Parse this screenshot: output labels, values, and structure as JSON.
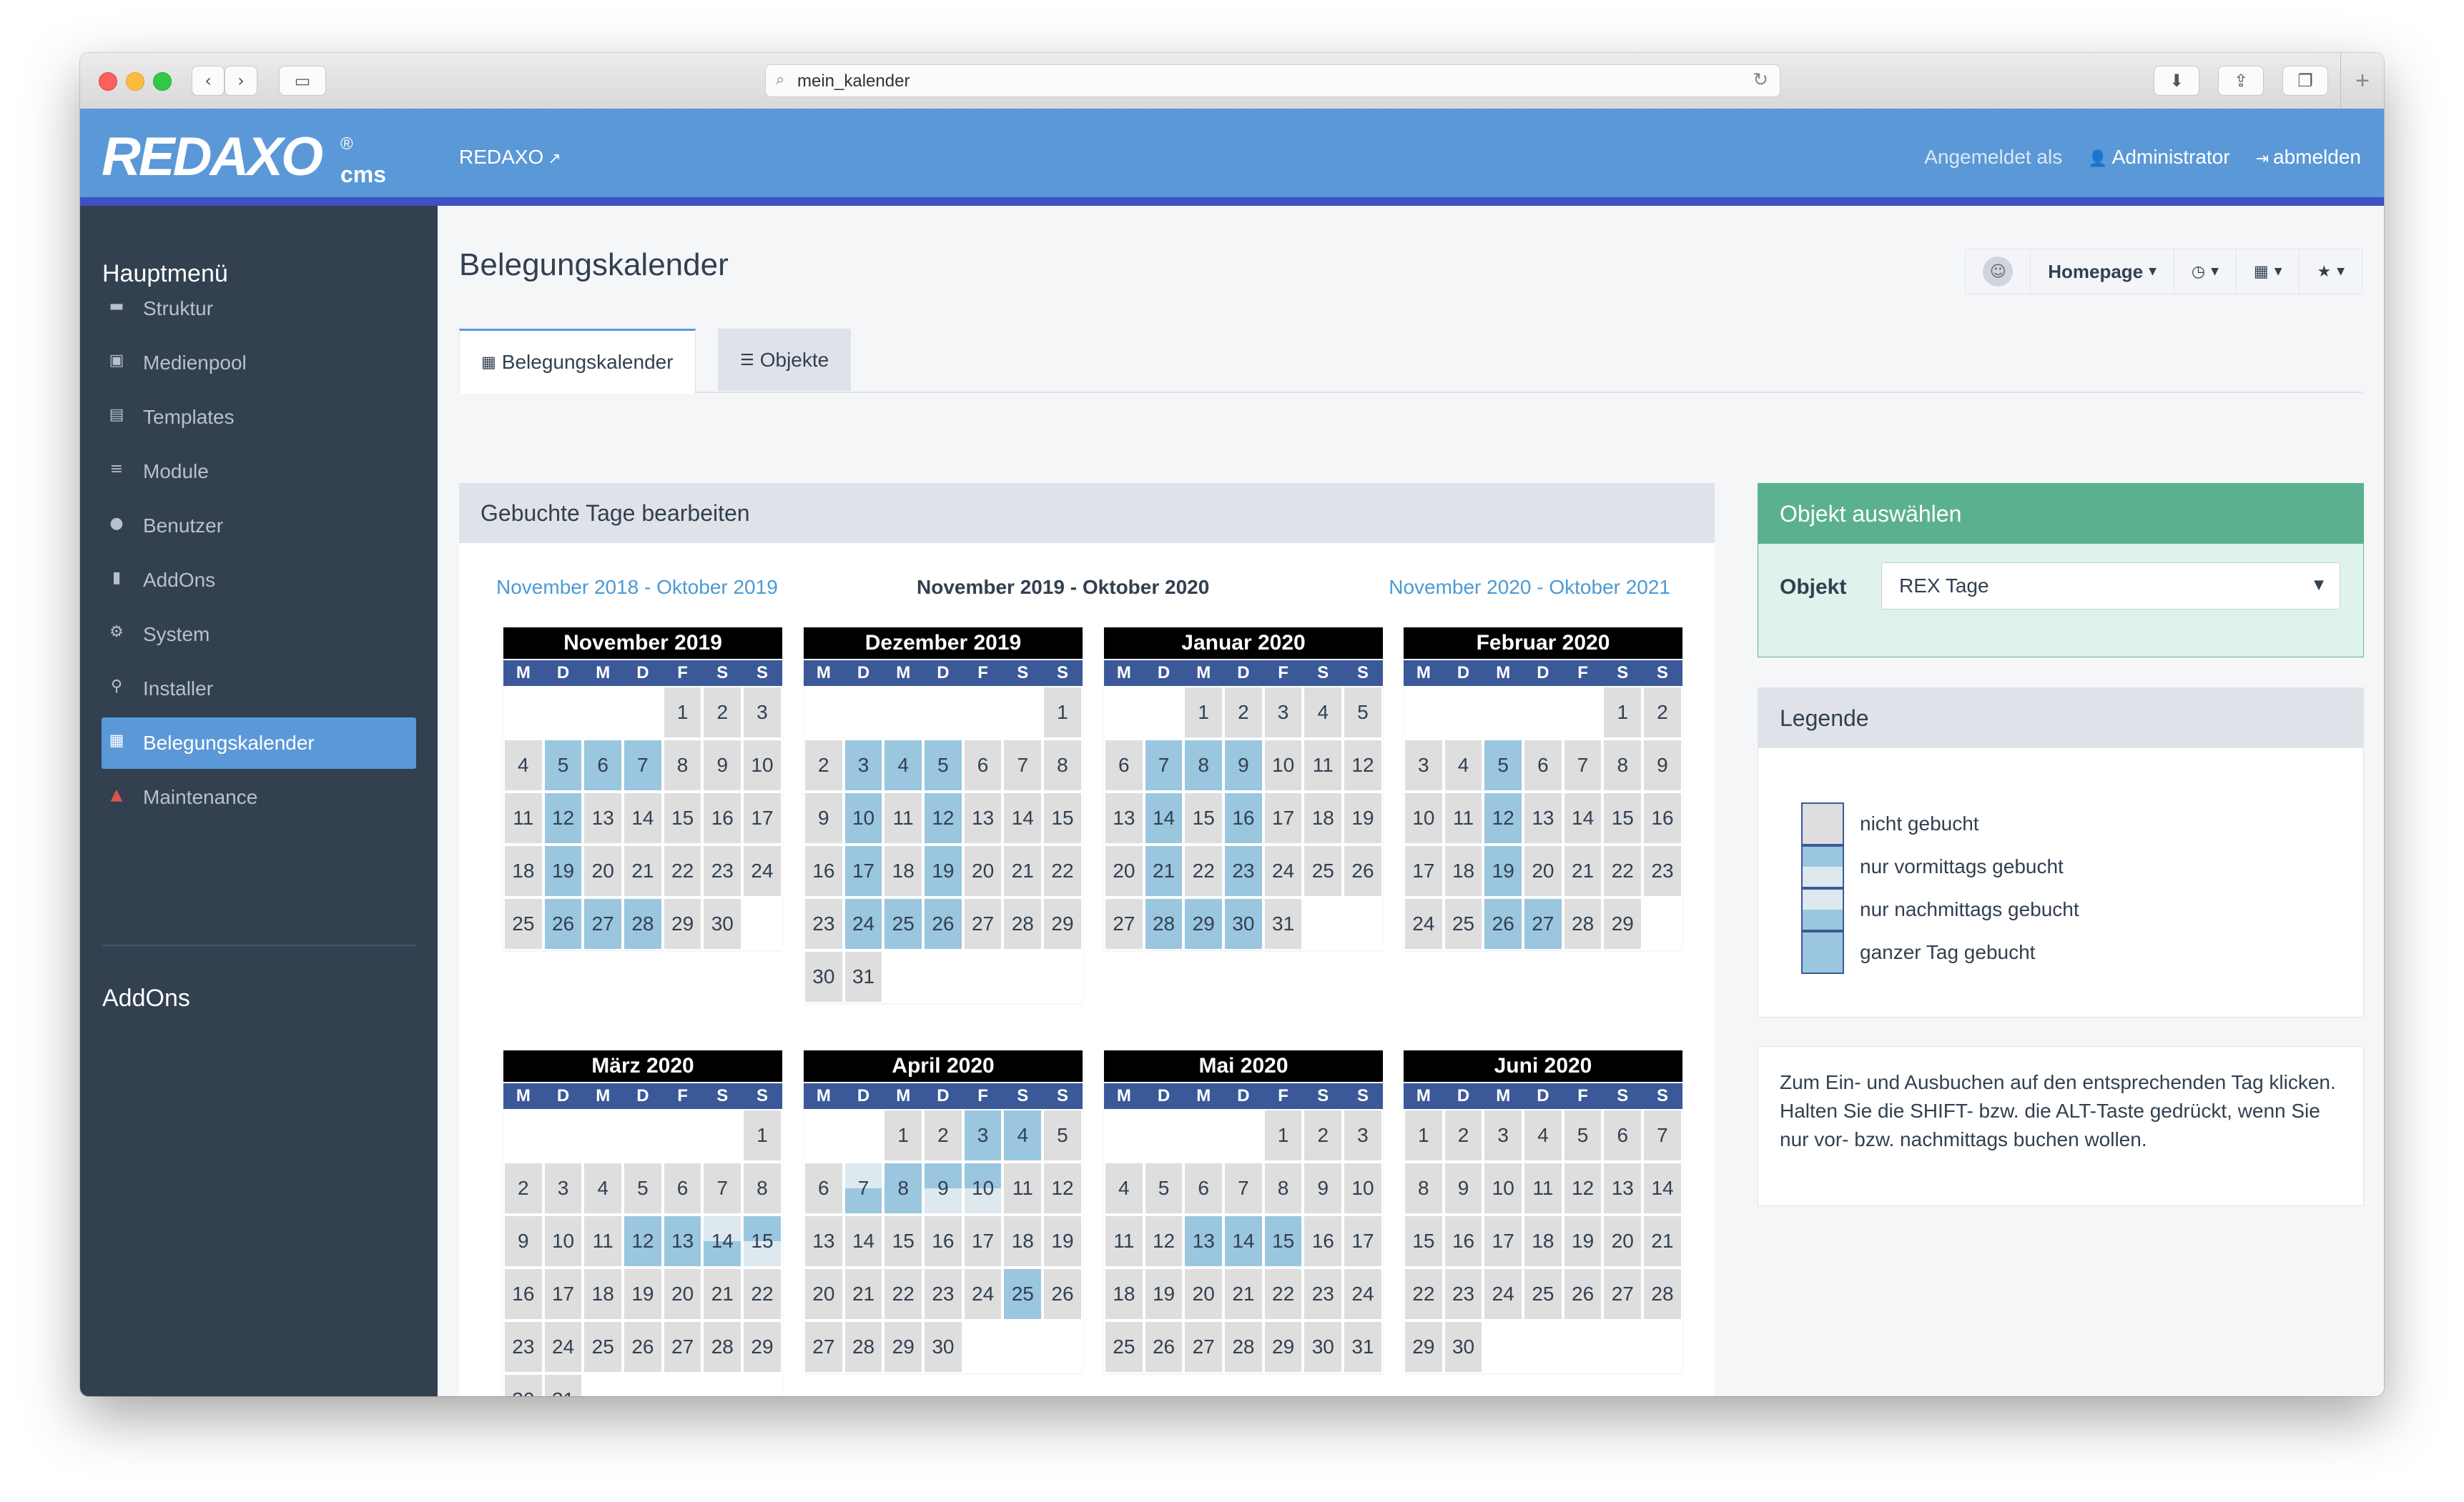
{
  "browser": {
    "url": "mein_kalender",
    "icons": [
      "back-icon",
      "forward-icon",
      "sidebar-icon",
      "reload-icon",
      "download-icon",
      "share-icon",
      "tabs-icon",
      "new-tab-icon"
    ]
  },
  "header": {
    "logo_main": "REDAXO",
    "logo_reg": "®",
    "logo_cms": "cms",
    "site_link": "REDAXO",
    "logged_in_label": "Angemeldet als",
    "user": "Administrator",
    "logout": "abmelden",
    "colors": {
      "header_bg": "#5b98d7",
      "header_border": "#3d50c4"
    }
  },
  "sidebar": {
    "title": "Hauptmenü",
    "items": [
      {
        "label": "Struktur",
        "icon": "folder-icon"
      },
      {
        "label": "Medienpool",
        "icon": "image-icon"
      },
      {
        "label": "Templates",
        "icon": "template-icon"
      },
      {
        "label": "Module",
        "icon": "database-icon"
      },
      {
        "label": "Benutzer",
        "icon": "user-icon"
      },
      {
        "label": "AddOns",
        "icon": "bookmark-icon"
      },
      {
        "label": "System",
        "icon": "cogs-icon"
      },
      {
        "label": "Installer",
        "icon": "key-icon"
      },
      {
        "label": "Belegungskalender",
        "icon": "calendar-icon",
        "active": true
      },
      {
        "label": "Maintenance",
        "icon": "warning-icon"
      }
    ],
    "addons_title": "AddOns",
    "colors": {
      "bg": "#324050",
      "active": "#5b98d7",
      "warning": "#d9534f"
    }
  },
  "main": {
    "title": "Belegungskalender",
    "toolbar": {
      "homepage": "Homepage"
    },
    "tabs": [
      {
        "label": "Belegungskalender",
        "icon": "calendar-icon",
        "active": true
      },
      {
        "label": "Objekte",
        "icon": "list-icon",
        "active": false
      }
    ]
  },
  "calendar": {
    "panel_title": "Gebuchte Tage bearbeiten",
    "prev_range": "November 2018 - Oktober 2019",
    "current_range": "November 2019 - Oktober 2020",
    "next_range": "November 2020 - Oktober 2021",
    "weekdays": [
      "M",
      "D",
      "M",
      "D",
      "F",
      "S",
      "S"
    ],
    "months": [
      {
        "name": "November 2019",
        "offset": 4,
        "days": 30,
        "full": [
          5,
          6,
          7,
          12,
          19,
          26,
          27,
          28
        ],
        "am": [],
        "pm": []
      },
      {
        "name": "Dezember 2019",
        "offset": 6,
        "days": 31,
        "full": [
          3,
          4,
          5,
          10,
          12,
          17,
          19,
          24,
          25,
          26
        ],
        "am": [],
        "pm": []
      },
      {
        "name": "Januar 2020",
        "offset": 2,
        "days": 31,
        "full": [
          7,
          8,
          9,
          14,
          16,
          21,
          23,
          28,
          29,
          30
        ],
        "am": [],
        "pm": []
      },
      {
        "name": "Februar 2020",
        "offset": 5,
        "days": 29,
        "full": [
          5,
          12,
          19,
          26,
          27
        ],
        "am": [],
        "pm": []
      },
      {
        "name": "März 2020",
        "offset": 6,
        "days": 31,
        "full": [
          12,
          13
        ],
        "am": [
          15
        ],
        "pm": [
          14
        ]
      },
      {
        "name": "April 2020",
        "offset": 2,
        "days": 30,
        "full": [
          3,
          4,
          8,
          25
        ],
        "am": [
          9,
          10
        ],
        "pm": [
          7
        ]
      },
      {
        "name": "Mai 2020",
        "offset": 4,
        "days": 31,
        "full": [
          13,
          14,
          15
        ],
        "am": [],
        "pm": []
      },
      {
        "name": "Juni 2020",
        "offset": 0,
        "days": 30,
        "full": [],
        "am": [],
        "pm": []
      }
    ],
    "colors": {
      "month_header": "#000000",
      "weekday_bar": "#3b5998",
      "free": "#dedede",
      "booked": "#9ac6e0",
      "half": "#dde9ef"
    }
  },
  "object_select": {
    "title": "Objekt auswählen",
    "label": "Objekt",
    "value": "REX Tage",
    "colors": {
      "head": "#5bb18f",
      "body": "#dff3ec"
    }
  },
  "legend": {
    "title": "Legende",
    "items": [
      {
        "label": "nicht gebucht",
        "type": "n"
      },
      {
        "label": "nur vormittags gebucht",
        "type": "am"
      },
      {
        "label": "nur nachmittags gebucht",
        "type": "pm"
      },
      {
        "label": "ganzer Tag gebucht",
        "type": "f"
      }
    ]
  },
  "hint": {
    "text": "Zum Ein- und Ausbuchen auf den entsprechenden Tag klicken. Halten Sie die SHIFT- bzw. die ALT-Taste gedrückt, wenn Sie nur vor- bzw. nachmittags buchen wollen."
  }
}
